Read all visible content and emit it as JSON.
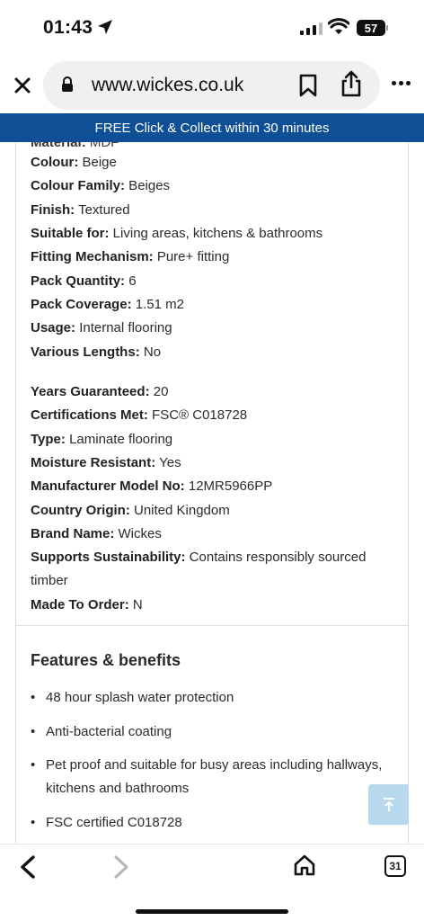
{
  "status_bar": {
    "time": "01:43",
    "battery": "57"
  },
  "browser": {
    "url": "www.wickes.co.uk"
  },
  "promo_banner": "FREE Click & Collect within 30 minutes",
  "specs": {
    "cut_off": {
      "label": "Material:",
      "value": "MDF"
    },
    "group1": [
      {
        "label": "Colour:",
        "value": " Beige"
      },
      {
        "label": "Colour Family:",
        "value": " Beiges"
      },
      {
        "label": "Finish:",
        "value": " Textured"
      },
      {
        "label": "Suitable for:",
        "value": " Living areas, kitchens & bathrooms"
      },
      {
        "label": "Fitting Mechanism:",
        "value": " Pure+ fitting"
      },
      {
        "label": "Pack Quantity:",
        "value": " 6"
      },
      {
        "label": "Pack Coverage:",
        "value": " 1.51 m2"
      },
      {
        "label": "Usage:",
        "value": " Internal flooring"
      },
      {
        "label": "Various Lengths:",
        "value": " No"
      }
    ],
    "group2": [
      {
        "label": "Years Guaranteed:",
        "value": " 20"
      },
      {
        "label": "Certifications Met:",
        "value": " FSC® C018728"
      },
      {
        "label": "Type:",
        "value": " Laminate flooring"
      },
      {
        "label": "Moisture Resistant:",
        "value": " Yes"
      },
      {
        "label": "Manufacturer Model No:",
        "value": " 12MR5966PP"
      },
      {
        "label": "Country Origin:",
        "value": " United Kingdom"
      },
      {
        "label": "Brand Name:",
        "value": " Wickes"
      },
      {
        "label": "Supports Sustainability:",
        "value": " Contains responsibly sourced timber"
      },
      {
        "label": "Made To Order:",
        "value": " N"
      }
    ]
  },
  "features": {
    "title": "Features & benefits",
    "items": [
      "48 hour splash water protection",
      "Anti-bacterial coating",
      "Pet proof and suitable for busy areas including hallways, kitchens and bathrooms",
      "FSC certified C018728"
    ]
  },
  "toolbar": {
    "tabs_count": "31"
  },
  "colors": {
    "brand_blue": "#0e4f96",
    "scroll_button": "#b8d8ee"
  }
}
